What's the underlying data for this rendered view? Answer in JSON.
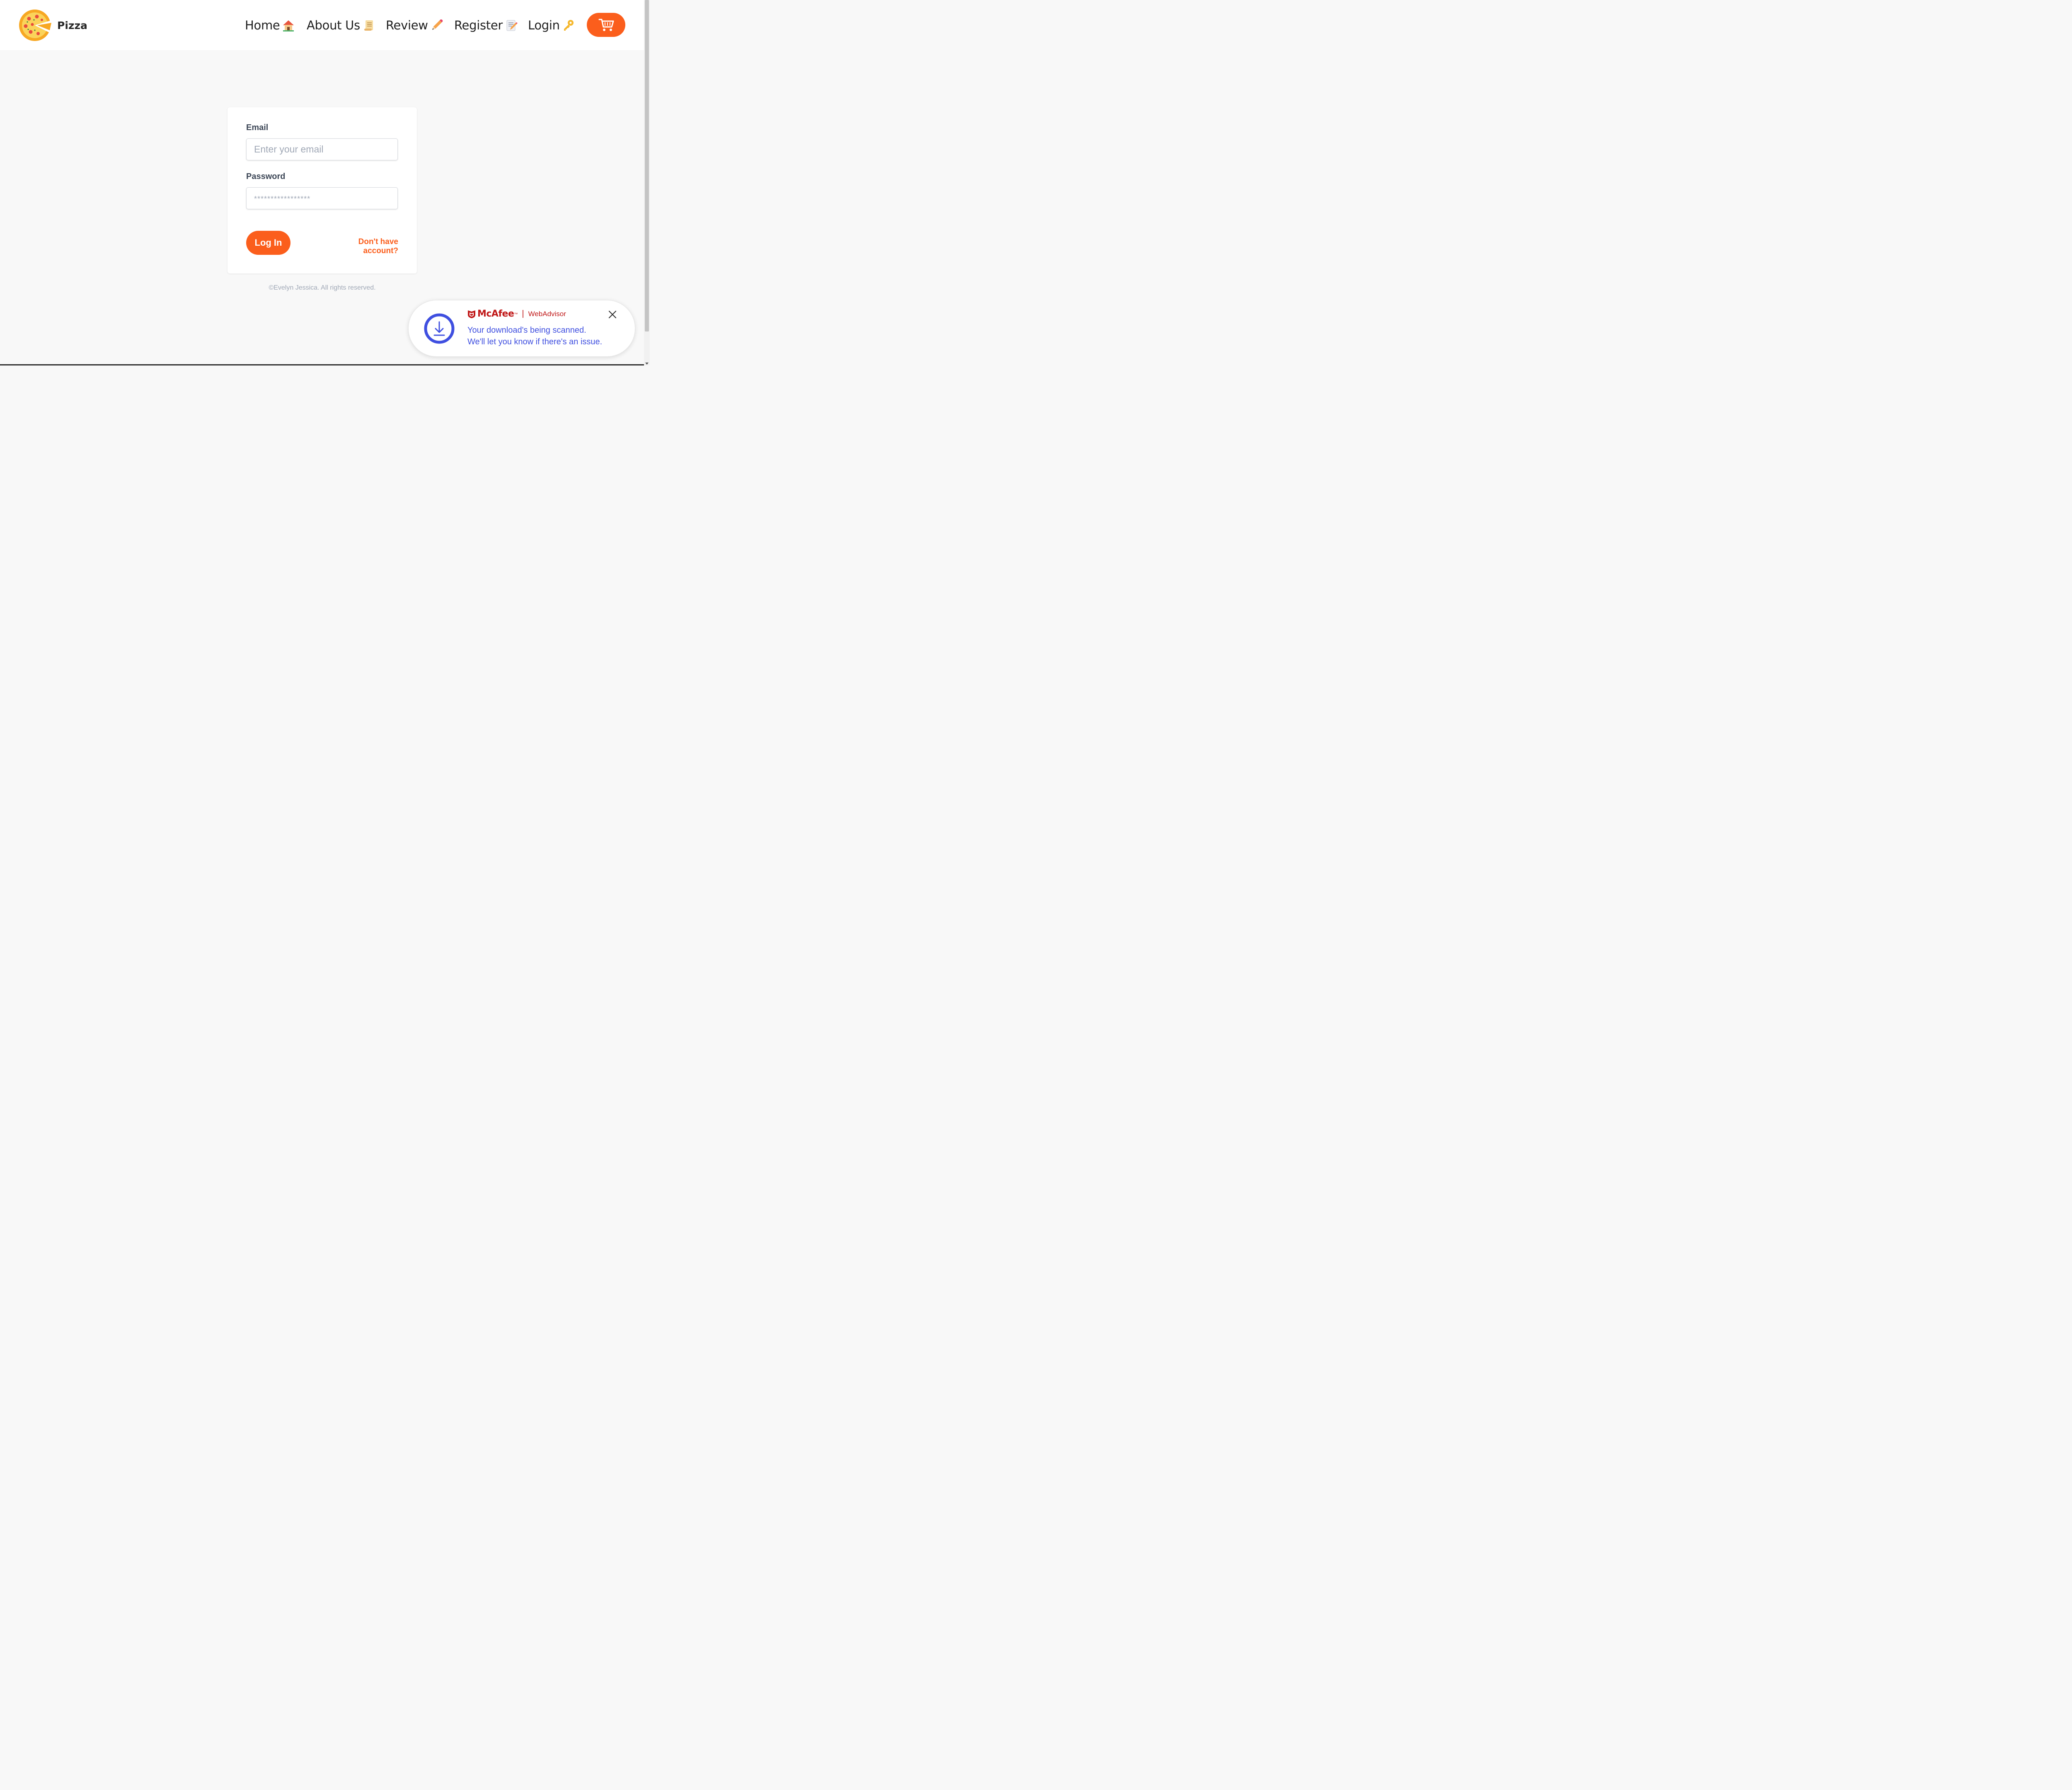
{
  "brand": {
    "name": "Pizza",
    "logo_icon": "pizza-icon"
  },
  "nav": {
    "items": [
      {
        "label": "Home",
        "icon": "house-icon"
      },
      {
        "label": "About Us",
        "icon": "scroll-icon"
      },
      {
        "label": "Review",
        "icon": "pencil-icon"
      },
      {
        "label": "Register",
        "icon": "memo-icon"
      },
      {
        "label": "Login",
        "icon": "key-icon"
      }
    ],
    "cart_icon": "cart-icon"
  },
  "login_form": {
    "email_label": "Email",
    "email_placeholder": "Enter your email",
    "password_label": "Password",
    "password_placeholder": "*****************",
    "submit_label": "Log In",
    "signup_link": "Don't have account?"
  },
  "footer": {
    "copyright": "©Evelyn Jessica. All rights reserved."
  },
  "toast": {
    "brand": "McAfee",
    "brand_mark": "™",
    "product": "WebAdvisor",
    "message_line1": "Your download's being scanned.",
    "message_line2": "We'll let you know if there's an issue."
  },
  "colors": {
    "accent": "#fb5e1c",
    "toast_text": "#3f4fe0",
    "mcafee_red": "#c01818"
  }
}
